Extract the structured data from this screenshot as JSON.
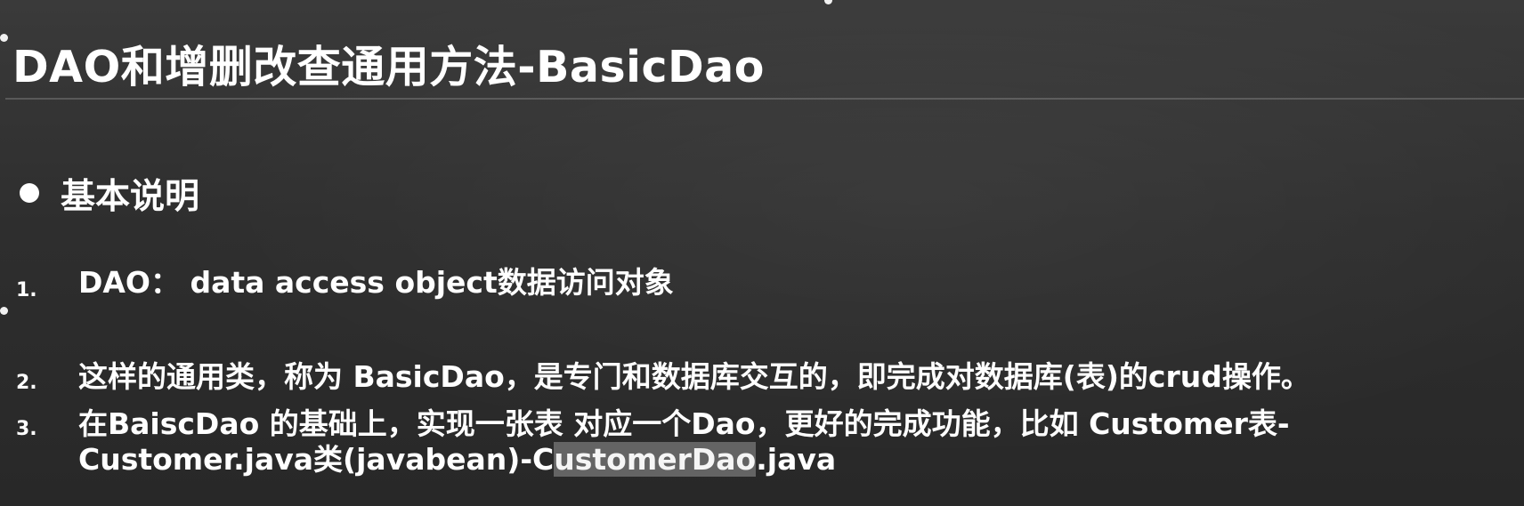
{
  "slide": {
    "title": "DAO和增删改查通用方法-BasicDao",
    "section": "基本说明",
    "items": [
      {
        "number": "1.",
        "text": "DAO： data access object数据访问对象"
      },
      {
        "number": "2.",
        "text": "这样的通用类，称为 BasicDao，是专门和数据库交互的，即完成对数据库(表)的crud操作。"
      },
      {
        "number": "3.",
        "line1": "在BaiscDao 的基础上，实现一张表 对应一个Dao，更好的完成功能，比如 Customer表-",
        "line2_before": "Customer.java类(javabean)-C",
        "line2_selected": "ustomerDao",
        "line2_after": ".java"
      }
    ]
  },
  "colors": {
    "background": "#2f2f2f",
    "text": "#ffffff",
    "selection": "#969696"
  }
}
